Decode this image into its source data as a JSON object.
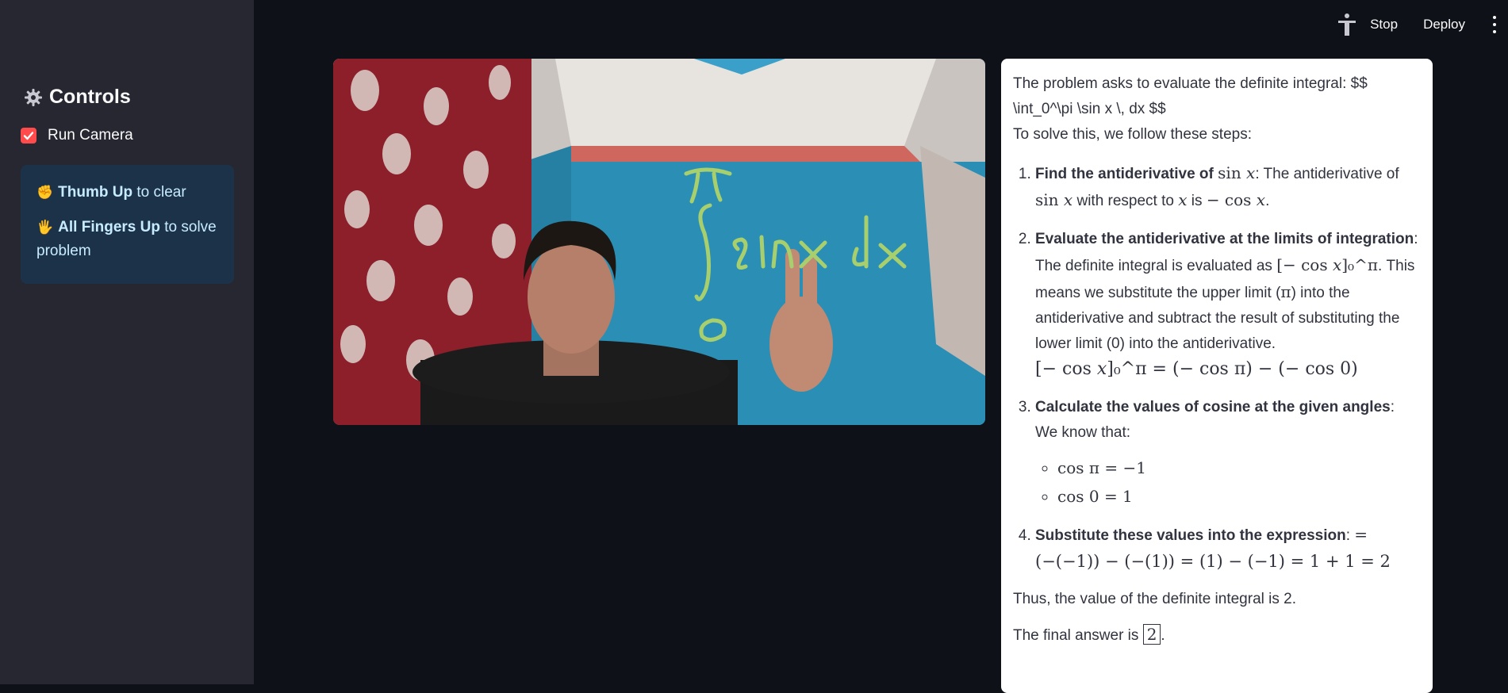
{
  "header": {
    "stop_label": "Stop",
    "deploy_label": "Deploy"
  },
  "sidebar": {
    "title": "Controls",
    "run_camera": {
      "label": "Run Camera",
      "checked": true
    },
    "instructions": [
      {
        "emoji": "✊",
        "bold": "Thumb Up",
        "rest": " to clear"
      },
      {
        "emoji": "🖐",
        "bold": "All Fingers Up",
        "rest": " to solve problem"
      }
    ]
  },
  "camera": {
    "drawn_text": [
      "π",
      "∫",
      "sinx dx",
      "0"
    ]
  },
  "solution": {
    "intro_line1": "The problem asks to evaluate the definite integral: $$",
    "intro_line2": "\\int_0^\\pi \\sin x \\, dx $$",
    "intro_line3": "To solve this, we follow these steps:",
    "steps": [
      {
        "bold": "Find the antiderivative of ",
        "math1": "sin 𝑥",
        "text1": ": The antiderivative of ",
        "math2": "sin 𝑥",
        "text2": " with respect to ",
        "math3": "𝑥",
        "text3": " is ",
        "math4": "− cos 𝑥",
        "text4": "."
      },
      {
        "bold": "Evaluate the antiderivative at the limits of integration",
        "text1": ": The definite integral is evaluated as ",
        "math1": "[− cos 𝑥]₀^π",
        "text2": ". This means we substitute the upper limit (",
        "math2": "π",
        "text3": ") into the antiderivative and subtract the result of substituting the lower limit (0) into the antiderivative.",
        "display": "[− cos 𝑥]₀^π = (− cos π) − (− cos 0)"
      },
      {
        "bold": "Calculate the values of cosine at the given angles",
        "text1": ": We know that:",
        "items": [
          "cos π = −1",
          "cos 0 = 1"
        ]
      },
      {
        "bold": "Substitute these values into the expression",
        "text1": ": ",
        "math1": "=",
        "display": "(−(−1)) − (−(1)) = (1) − (−1) = 1 + 1 = 2"
      }
    ],
    "conclusion": "Thus, the value of the definite integral is 2.",
    "final_prefix": "The final answer is ",
    "final_value": "2",
    "final_suffix": "."
  },
  "colors": {
    "accent": "#ff4b4b",
    "info_bg": "#1c3249",
    "info_text": "#c7ebff",
    "sidebar_bg": "#262730",
    "app_bg": "#0e1117"
  }
}
